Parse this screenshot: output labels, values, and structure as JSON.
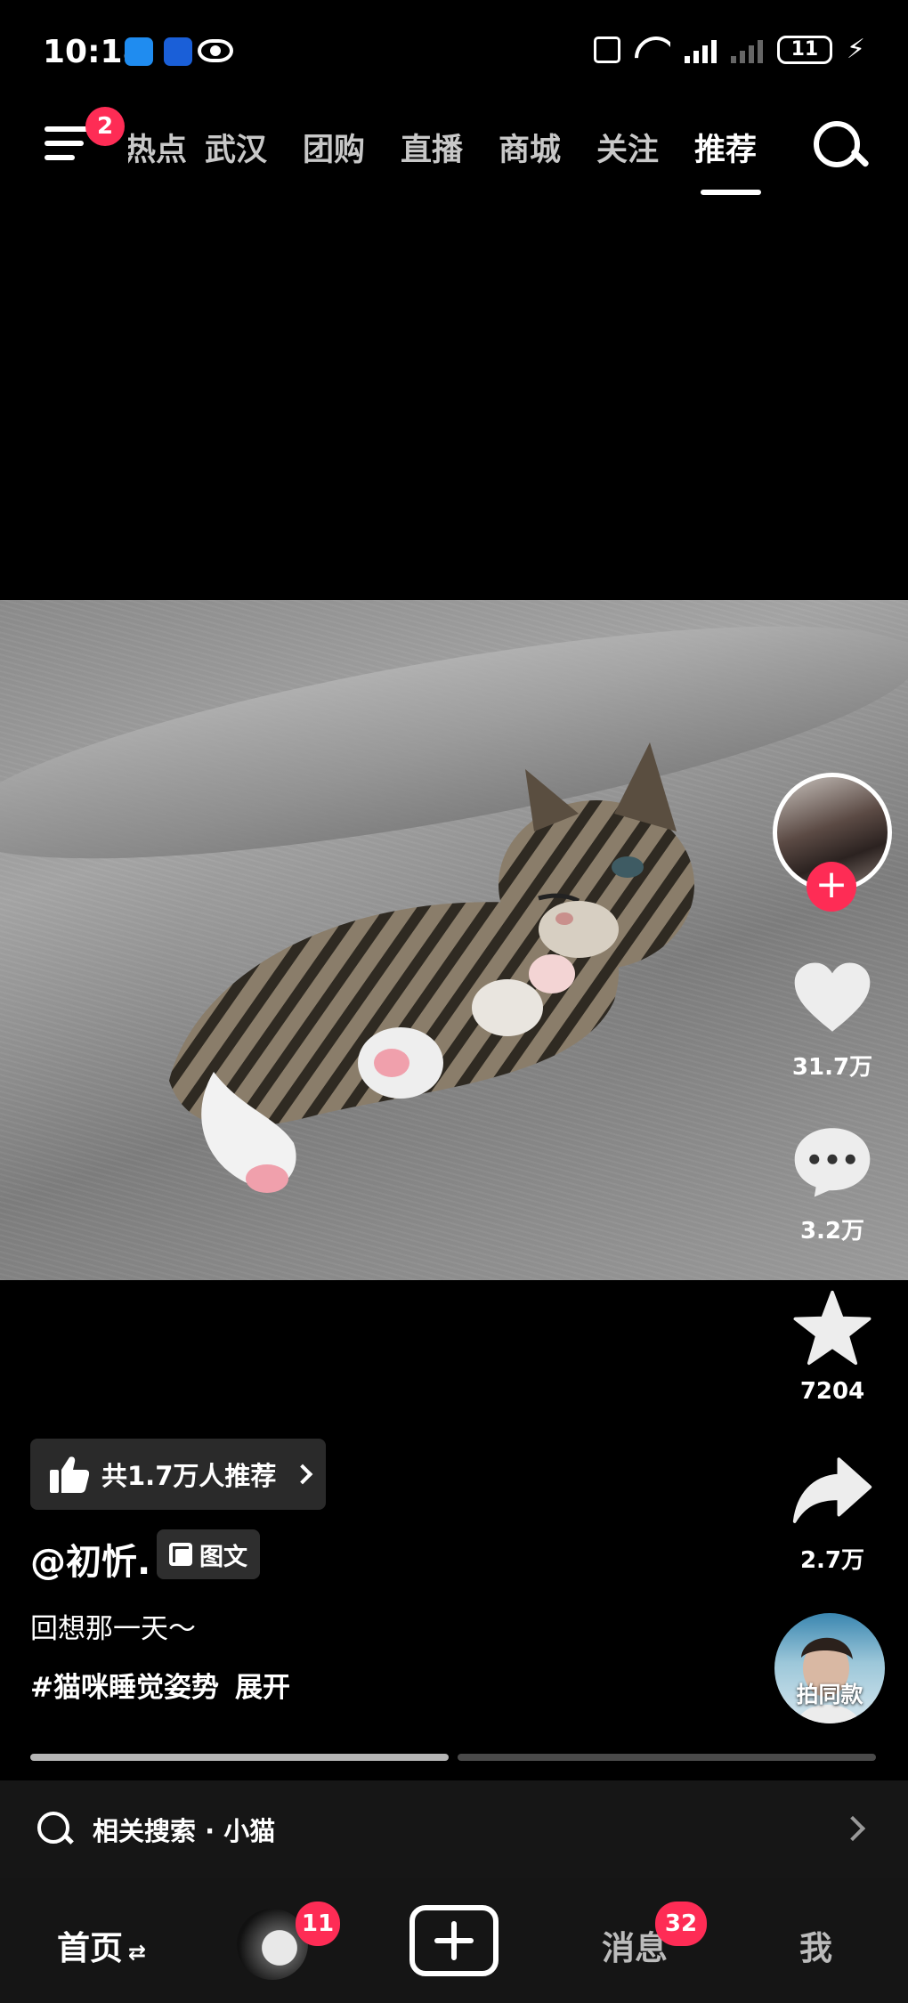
{
  "status_bar": {
    "time": "10:18",
    "battery": "11",
    "charging_icon": "bolt-icon",
    "app_icons": [
      "message-app-icon",
      "blue-app-icon",
      "eye-icon"
    ]
  },
  "top_nav": {
    "menu_badge": "2",
    "tabs": [
      "热点",
      "武汉",
      "团购",
      "直播",
      "商城",
      "关注",
      "推荐"
    ],
    "active_tab": "推荐"
  },
  "post": {
    "image_subject_icon": "sleeping-kitten-photo",
    "recommend_text": "共1.7万人推荐",
    "author": "@初忻.",
    "type_label": "图文",
    "caption": "回想那一天～",
    "hashtag": "#猫咪睡觉姿势",
    "expand_label": "展开"
  },
  "actions": {
    "likes": "31.7万",
    "comments": "3.2万",
    "favorites": "7204",
    "shares": "2.7万",
    "same_style_label": "拍同款",
    "follow_symbol": "+"
  },
  "progress": {
    "current_page": 1,
    "total_pages": 2
  },
  "related_search": {
    "label": "相关搜索 · 小猫"
  },
  "bottom_nav": {
    "home": "首页",
    "home_swap": "⇄",
    "friends_badge": "11",
    "messages": "消息",
    "messages_badge": "32",
    "me": "我"
  },
  "colors": {
    "accent": "#fe2c55",
    "background": "#000000"
  }
}
